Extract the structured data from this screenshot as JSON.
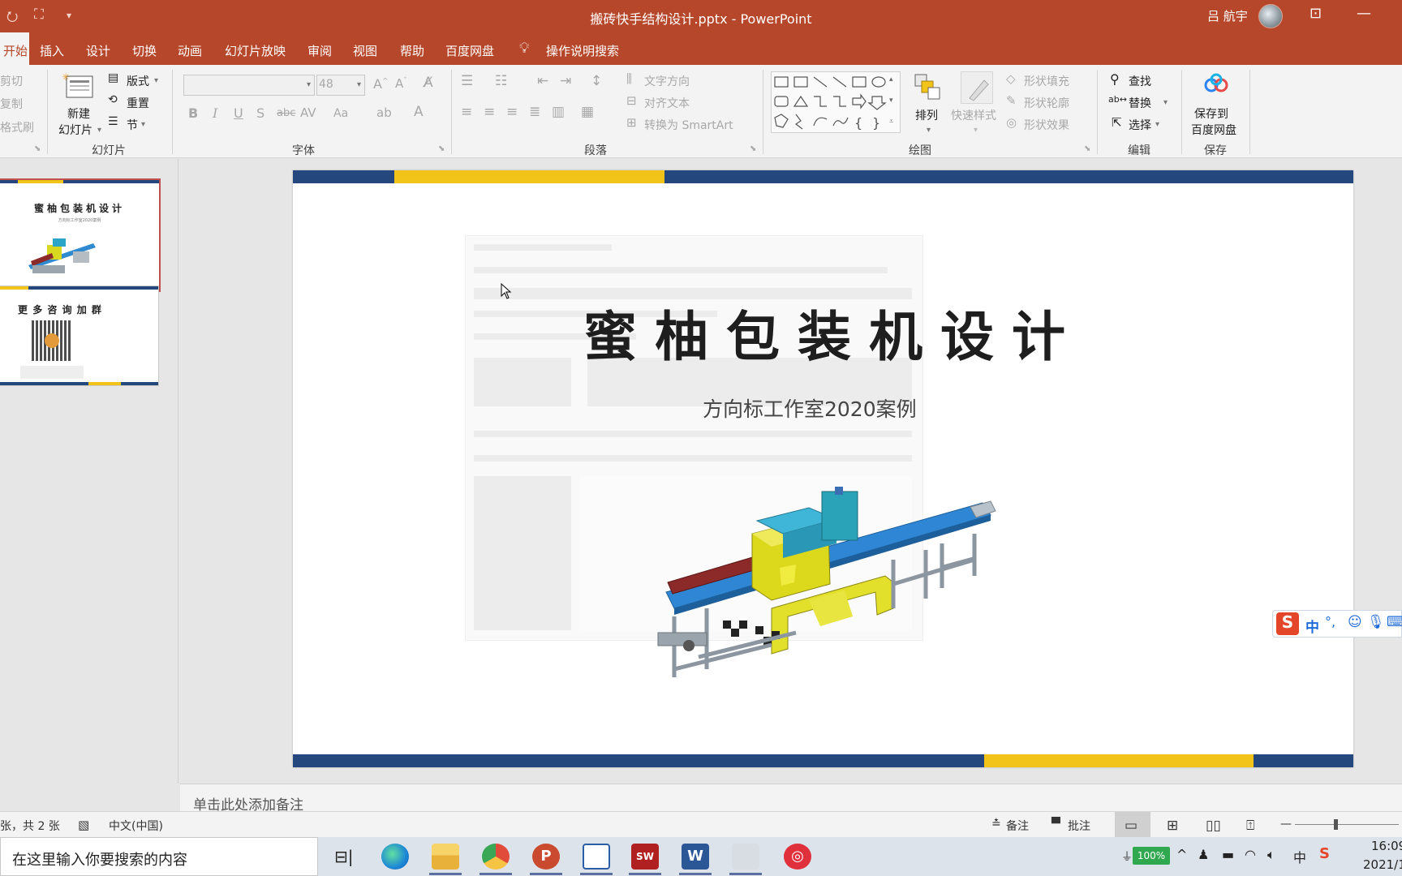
{
  "window": {
    "title": "搬砖快手结构设计.pptx  -  PowerPoint",
    "user": "吕 航宇"
  },
  "tabs": [
    "开始",
    "插入",
    "设计",
    "切换",
    "动画",
    "幻灯片放映",
    "审阅",
    "视图",
    "帮助",
    "百度网盘",
    "操作说明搜索"
  ],
  "ribbon": {
    "clipboard": {
      "cut": "剪切",
      "copy": "复制",
      "format_painter": "格式刷"
    },
    "slides": {
      "new_slide_line1": "新建",
      "new_slide_line2": "幻灯片",
      "layout": "版式",
      "reset": "重置",
      "section": "节",
      "label": "幻灯片"
    },
    "font": {
      "size": "48",
      "label": "字体"
    },
    "paragraph": {
      "text_direction": "文字方向",
      "align_text": "对齐文本",
      "smartart": "转换为 SmartArt",
      "label": "段落"
    },
    "drawing": {
      "arrange": "排列",
      "quick_styles": "快速样式",
      "shape_fill": "形状填充",
      "shape_outline": "形状轮廓",
      "shape_effects": "形状效果",
      "label": "绘图"
    },
    "editing": {
      "find": "查找",
      "replace": "替换",
      "select": "选择",
      "label": "编辑"
    },
    "save": {
      "line1": "保存到",
      "line2": "百度网盘",
      "label": "保存"
    }
  },
  "thumbnails": [
    {
      "title": "蜜柚包装机设计",
      "subtitle": "方向标工作室2020案例"
    },
    {
      "title": "更 多 咨 询 加 群"
    }
  ],
  "slide": {
    "title": "蜜柚包装机设计",
    "subtitle": "方向标工作室2020案例"
  },
  "notes_placeholder": "单击此处添加备注",
  "status": {
    "slide_count": "张，共 2 张",
    "language": "中文(中国)",
    "notes": "备注",
    "comments": "批注"
  },
  "taskbar": {
    "search_placeholder": "在这里输入你要搜索的内容",
    "battery": "100%",
    "ime": "中",
    "time": "16:09",
    "date": "2021/1"
  },
  "colors": {
    "accent": "#b7472a",
    "slide_navy": "#24487e",
    "slide_yellow": "#f2c318"
  }
}
